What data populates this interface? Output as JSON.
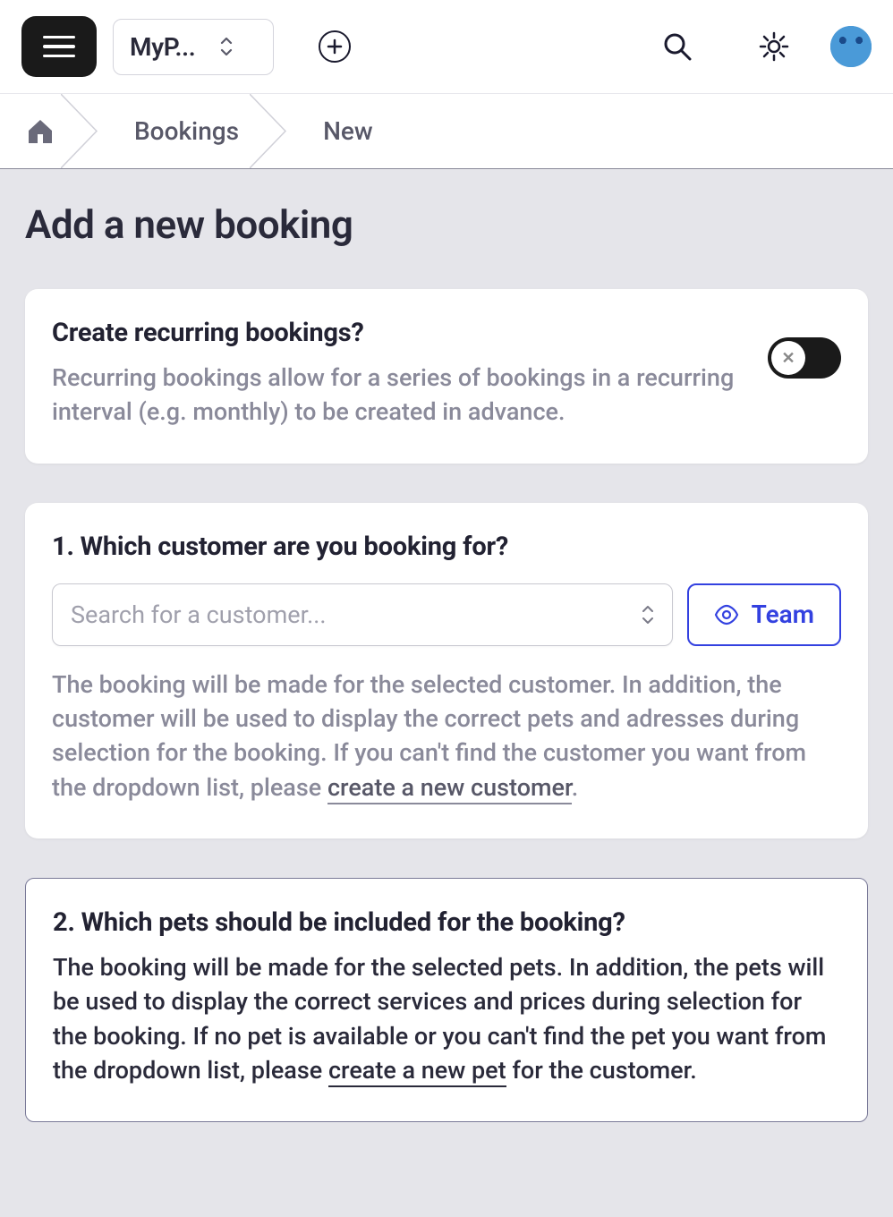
{
  "header": {
    "selector_label": "MyP...",
    "icons": {
      "menu": "menu-icon",
      "add": "plus-icon",
      "search": "search-icon",
      "theme": "sun-icon",
      "avatar": "avatar"
    }
  },
  "breadcrumb": [
    {
      "label": "",
      "icon": "home-icon"
    },
    {
      "label": "Bookings"
    },
    {
      "label": "New"
    }
  ],
  "page": {
    "title": "Add a new booking"
  },
  "recurring": {
    "title": "Create recurring bookings?",
    "desc": "Recurring bookings allow for a series of bookings in a recurring interval (e.g. monthly) to be created in advance.",
    "toggle_state": "off",
    "toggle_glyph": "✕"
  },
  "customer": {
    "title": "1. Which customer are you booking for?",
    "placeholder": "Search for a customer...",
    "team_label": "Team",
    "desc_pre": "The booking will be made for the selected customer. In addition, the customer will be used to display the correct pets and adresses during selection for the booking. If you can't find the customer you want from the dropdown list, please ",
    "link": "create a new customer",
    "desc_post": "."
  },
  "pets": {
    "title": "2. Which pets should be included for the booking?",
    "desc_pre": "The booking will be made for the selected pets. In addition, the pets will be used to display the correct services and prices during selection for the booking. If no pet is available or you can't find the pet you want from the dropdown list, please ",
    "link": "create a new pet",
    "desc_post": " for the customer."
  }
}
